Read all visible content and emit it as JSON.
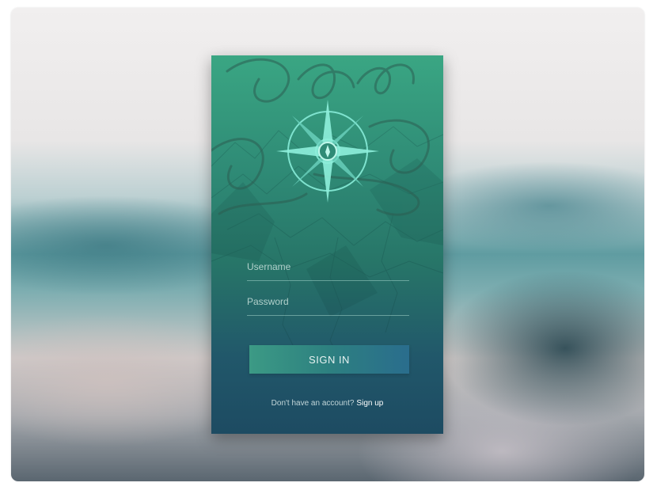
{
  "login": {
    "username_placeholder": "Username",
    "password_placeholder": "Password",
    "signin_label": "SIGN IN",
    "signup_prompt": "Don't have an account?",
    "signup_link": "Sign up"
  },
  "icons": {
    "logo": "compass-rose-icon"
  },
  "colors": {
    "card_top": "#3aa683",
    "card_bottom": "#1d4b62",
    "button_left": "#3c9a85",
    "button_right": "#2a6d8d",
    "compass": "#7fe3cf"
  }
}
